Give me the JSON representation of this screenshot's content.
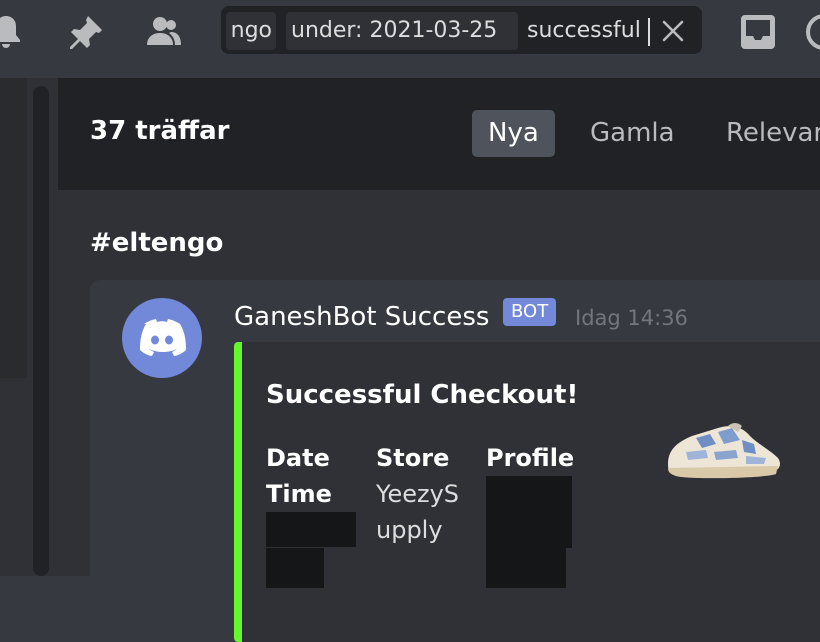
{
  "toolbar": {
    "icons": [
      "bell-icon",
      "pin-icon",
      "members-icon",
      "inbox-icon",
      "help-icon"
    ]
  },
  "search": {
    "chip_in": "ngo",
    "chip_during": "under: 2021-03-25",
    "query": "successful",
    "clear_icon": "close-icon"
  },
  "results": {
    "count_label": "37 träffar",
    "sort_tabs": [
      {
        "label": "Nya",
        "active": true
      },
      {
        "label": "Gamla",
        "active": false
      },
      {
        "label": "Relevar",
        "active": false
      }
    ]
  },
  "channel": {
    "name": "#eltengo"
  },
  "message": {
    "author": "GaneshBot Success",
    "bot_badge": "BOT",
    "timestamp": "Idag 14:36",
    "avatar_icon": "discord-logo-icon",
    "avatar_color": "#7289da"
  },
  "embed": {
    "accent_color": "#65f72b",
    "title": "Successful Checkout!",
    "fields": [
      {
        "name_line1": "Date",
        "name_line2": "Time"
      },
      {
        "name": "Store",
        "value_line1": "YeezyS",
        "value_line2": "upply"
      },
      {
        "name": "Profile"
      }
    ],
    "thumbnail_icon": "sneaker-icon"
  },
  "colors": {
    "background": "#36393f",
    "sidebar": "#2f3136",
    "header": "#202225",
    "bot_tag": "#7289da",
    "selected_tab": "#4f545c"
  }
}
